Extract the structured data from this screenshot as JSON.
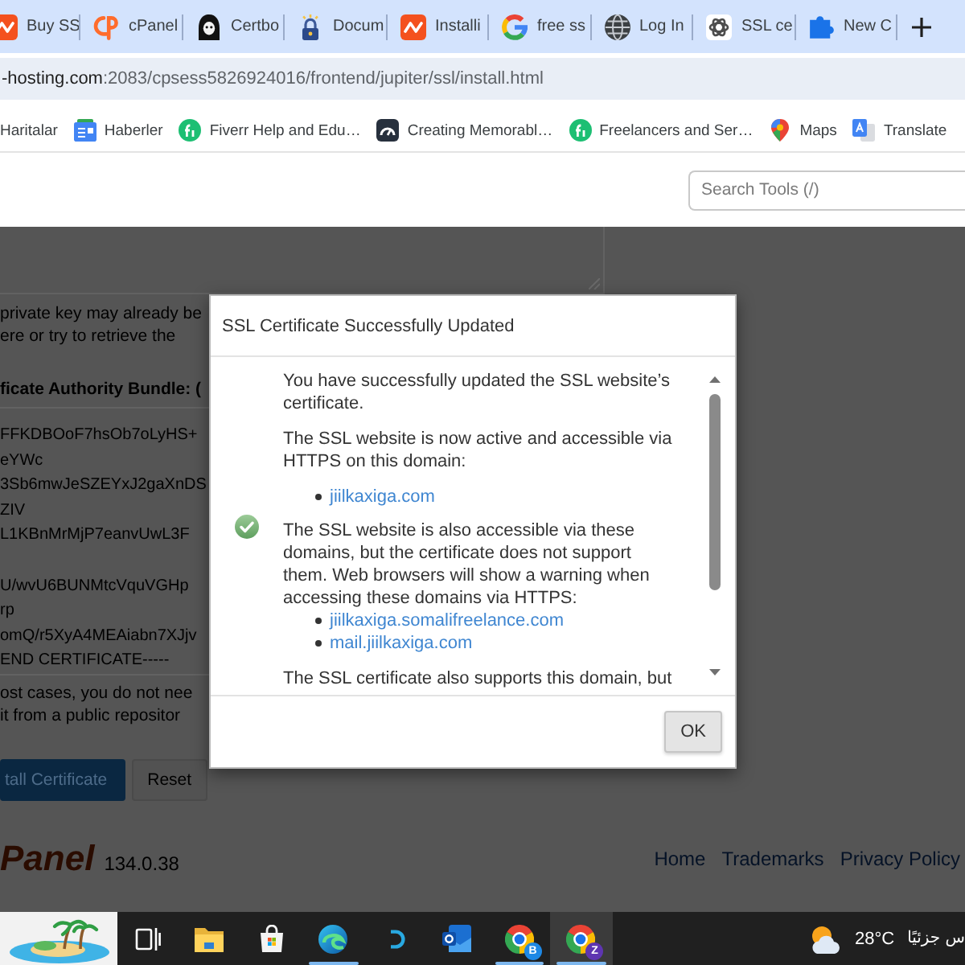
{
  "browser_tabs": [
    {
      "title": "Buy SS"
    },
    {
      "title": "cPanel"
    },
    {
      "title": "Certbo"
    },
    {
      "title": "Docum"
    },
    {
      "title": "Installi"
    },
    {
      "title": "free ss"
    },
    {
      "title": "Log In"
    },
    {
      "title": "SSL ce"
    },
    {
      "title": "New C"
    }
  ],
  "address_bar": {
    "host": "-hosting.com",
    "path": ":2083/cpsess5826924016/frontend/jupiter/ssl/install.html"
  },
  "bookmarks": [
    {
      "label": "Haritalar"
    },
    {
      "label": "Haberler"
    },
    {
      "label": "Fiverr Help and Edu…"
    },
    {
      "label": "Creating Memorabl…"
    },
    {
      "label": "Freelancers and Ser…"
    },
    {
      "label": "Maps"
    },
    {
      "label": "Translate"
    }
  ],
  "search": {
    "placeholder": "Search Tools (/)"
  },
  "page": {
    "key_hint": [
      "private key may already be",
      "ere or try to retrieve the"
    ],
    "bundle_label": "ficate Authority Bundle: (",
    "certificate_text": "FFKDBOoF7hsOb7oLyHS+\neYWc\n3Sb6mwJeSZEYxJ2gaXnDS\nZIV\nL1KBnMrMjP7eanvUwL3F\n\nU/wvU6BUNMtcVquVGHp\nrp\nomQ/r5XyA4MEAiabn7XJjv\nEND CERTIFICATE-----",
    "bundle_hint": [
      "ost cases, you do not nee",
      "it from a public repositor"
    ],
    "buttons": [
      {
        "kind": "primary",
        "label": "tall Certificate"
      },
      {
        "kind": "secondary",
        "label": "Reset"
      }
    ]
  },
  "dialog": {
    "title": "SSL Certificate Successfully Updated",
    "content": [
      {
        "kind": "paragraph",
        "text": "You have successfully updated the SSL website’s certificate."
      },
      {
        "kind": "paragraph",
        "text": "The SSL website is now active and accessible via HTTPS on this domain:"
      },
      {
        "kind": "list",
        "items": [
          "jiilkaxiga.com"
        ]
      },
      {
        "kind": "paragraph_with_list",
        "text": "The SSL website is also accessible via these domains, but the certificate does not support them. Web browsers will show a warning when accessing these domains via HTTPS:",
        "items": [
          "jiilkaxiga.somalifreelance.com",
          "mail.jiilkaxiga.com"
        ]
      },
      {
        "kind": "paragraph",
        "text": "The SSL certificate also supports this domain, but"
      }
    ],
    "buttons": [
      "OK"
    ]
  },
  "footer": {
    "logo": "Panel",
    "version": "134.0.38",
    "links": [
      "Home",
      "Trademarks",
      "Privacy Policy"
    ]
  },
  "taskbar": {
    "apps": [
      {
        "running": false,
        "selected": false
      },
      {
        "running": false,
        "selected": false
      },
      {
        "running": true,
        "selected": false
      },
      {
        "running": false,
        "selected": false
      },
      {
        "running": false,
        "selected": false
      },
      {
        "running": true,
        "selected": false,
        "badge": {
          "text": "B",
          "color": "#1e88e5"
        }
      },
      {
        "running": true,
        "selected": true,
        "badge": {
          "text": "Z",
          "color": "#5e35b1"
        }
      }
    ],
    "weather": {
      "temperature": "28°C",
      "condition": "س جزئيًا"
    }
  }
}
